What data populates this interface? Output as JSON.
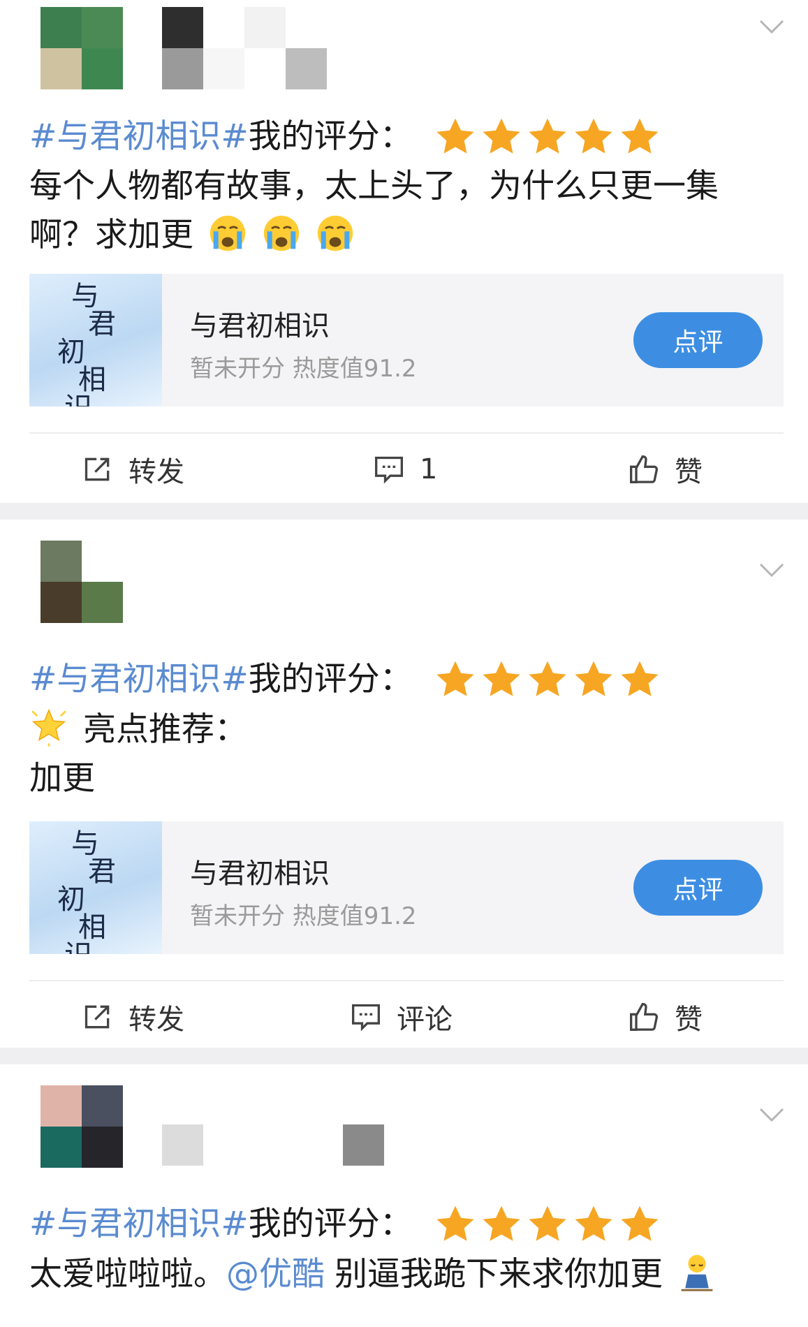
{
  "posts": [
    {
      "avatar_colors": [
        "#3d7f4e",
        "#4c8a55",
        "#cfc2a0",
        "#3f8750"
      ],
      "name_colors": [
        "#2e2e2e",
        "#f2f2f2",
        "#9a9a9a",
        "#f6f6f6",
        "#ffffff",
        "#bdbdbd"
      ],
      "topic": "#与君初相识#",
      "rating_label": "我的评分：",
      "rating": 5,
      "body_lines": [
        "每个人物都有故事，太上头了，为什么只更一集",
        "啊？求加更"
      ],
      "emoji_count": 3,
      "card": {
        "title": "与君初相识",
        "subtitle": "暂未开分 热度值91.2",
        "button": "点评"
      },
      "actions": {
        "repost": "转发",
        "comment": "1",
        "like": "赞"
      }
    },
    {
      "avatar_colors": [
        "#6b7a60",
        "#ffffff",
        "#4a3c2a",
        "#5a7a4a"
      ],
      "topic": "#与君初相识#",
      "rating_label": "我的评分：",
      "rating": 5,
      "highlight_label": "亮点推荐：",
      "body_line": "加更",
      "card": {
        "title": "与君初相识",
        "subtitle": "暂未开分 热度值91.2",
        "button": "点评"
      },
      "actions": {
        "repost": "转发",
        "comment": "评论",
        "like": "赞"
      }
    },
    {
      "avatar_colors": [
        "#e0b3a8",
        "#4a5060",
        "#1a6a60",
        "#25252a"
      ],
      "topic": "#与君初相识#",
      "rating_label": "我的评分：",
      "rating": 5,
      "body_prefix": "太爱啦啦啦。",
      "mention": "@优酷",
      "body_suffix": "别逼我跪下来求你加更"
    }
  ],
  "poster_text": [
    "与",
    "君",
    "初",
    "相",
    "识"
  ],
  "colors": {
    "topic": "#5b8bd0",
    "star": "#f6a623",
    "button": "#3d8ee3",
    "gap": "#efeff1"
  },
  "icons": {
    "chevron": "chevron-down-icon",
    "star": "star-icon",
    "repost": "repost-icon",
    "comment": "comment-icon",
    "like": "thumbs-up-icon",
    "emoji_cry": "crying-face-icon",
    "emoji_sparkle": "sparkle-star-icon",
    "emoji_pleading": "kneeling-person-icon"
  }
}
